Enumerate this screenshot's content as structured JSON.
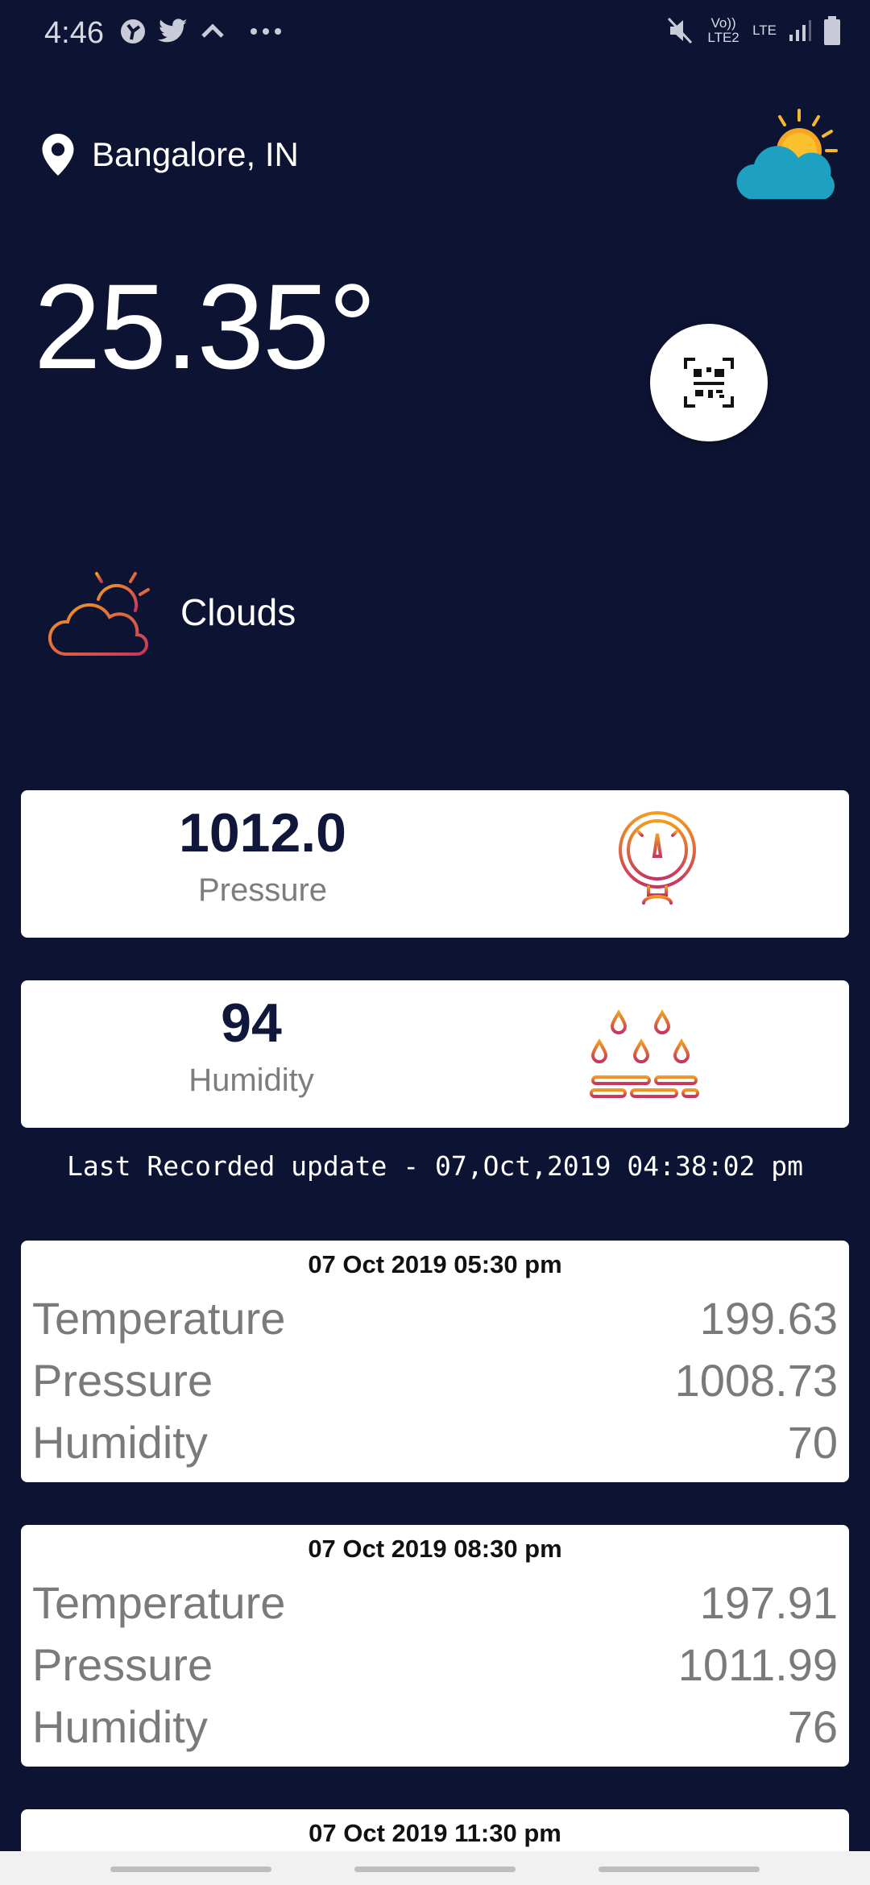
{
  "status_bar": {
    "time": "4:46",
    "volte_label": "Vo)) LTE2",
    "lte_label": "LTE"
  },
  "location": {
    "name": "Bangalore, IN"
  },
  "current": {
    "temperature": "25.35°",
    "condition": "Clouds"
  },
  "stats": [
    {
      "value": "1012.0",
      "label": "Pressure",
      "icon": "pressure-gauge-icon"
    },
    {
      "value": "94",
      "label": "Humidity",
      "icon": "humidity-drops-icon"
    }
  ],
  "last_update": "Last Recorded update - 07,Oct,2019 04:38:02 pm",
  "forecast": [
    {
      "date": "07 Oct 2019 05:30 pm",
      "rows": [
        {
          "label": "Temperature",
          "value": "199.63"
        },
        {
          "label": "Pressure",
          "value": "1008.73"
        },
        {
          "label": "Humidity",
          "value": "70"
        }
      ]
    },
    {
      "date": "07 Oct 2019 08:30 pm",
      "rows": [
        {
          "label": "Temperature",
          "value": "197.91"
        },
        {
          "label": "Pressure",
          "value": "1011.99"
        },
        {
          "label": "Humidity",
          "value": "76"
        }
      ]
    },
    {
      "date": "07 Oct 2019 11:30 pm"
    }
  ],
  "colors": {
    "background": "#0d1333",
    "card": "#ffffff",
    "accent_orange": "#f39c1f",
    "accent_magenta": "#b8336a"
  }
}
